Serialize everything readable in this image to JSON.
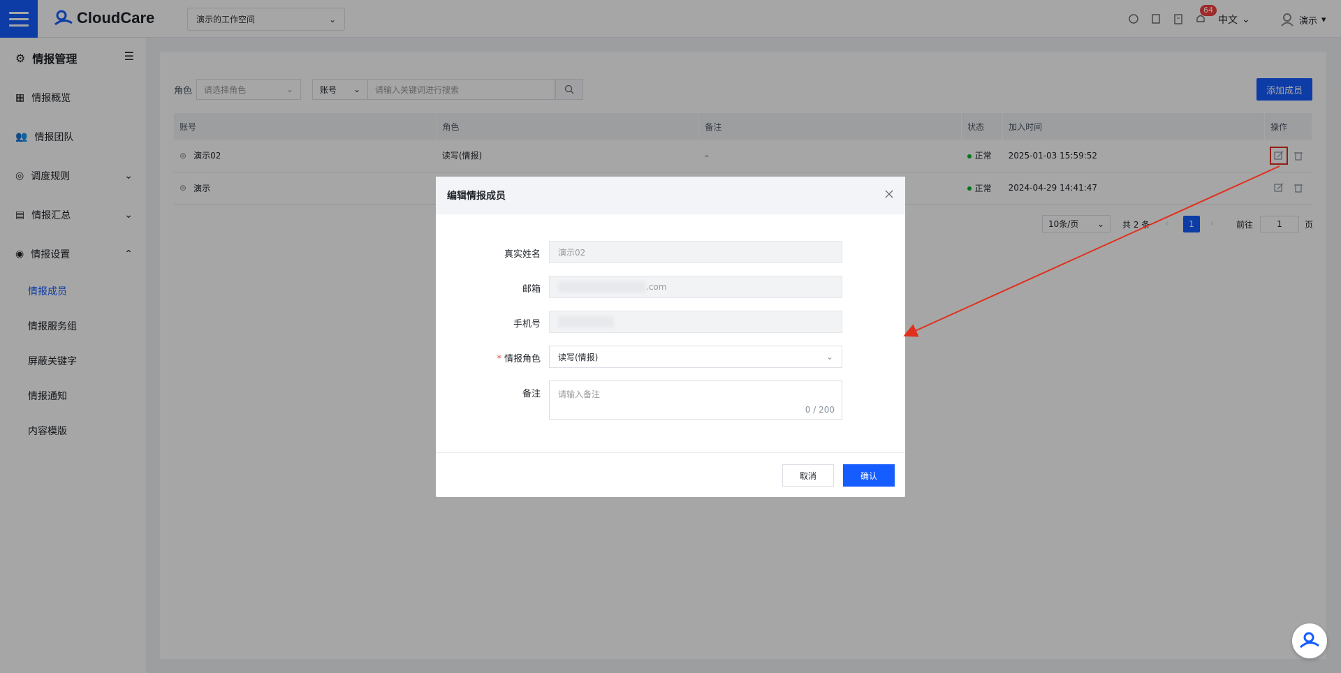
{
  "topbar": {
    "brand": "CloudCare",
    "workspace": "演示的工作空间",
    "notification_count": "64",
    "language": "中文",
    "user": "演示"
  },
  "sidebar": {
    "title": "情报管理",
    "items": [
      {
        "label": "情报概览",
        "icon": "dashboard-icon"
      },
      {
        "label": "情报团队",
        "icon": "team-icon"
      },
      {
        "label": "调度规则",
        "icon": "compass-icon"
      },
      {
        "label": "情报汇总",
        "icon": "document-icon"
      },
      {
        "label": "情报设置",
        "icon": "settings-icon"
      }
    ],
    "sub_items": [
      "情报成员",
      "情报服务组",
      "屏蔽关键字",
      "情报通知",
      "内容模版"
    ]
  },
  "filters": {
    "role_label": "角色",
    "role_placeholder": "请选择角色",
    "field_select": "账号",
    "search_placeholder": "请输入关键词进行搜索",
    "add_button": "添加成员"
  },
  "table": {
    "headers": [
      "账号",
      "角色",
      "备注",
      "状态",
      "加入时间",
      "操作"
    ],
    "rows": [
      {
        "account": "演示02",
        "role": "读写(情报)",
        "note": "–",
        "status": "正常",
        "joined": "2025-01-03 15:59:52"
      },
      {
        "account": "演示",
        "role": "",
        "note": "",
        "status": "正常",
        "joined": "2024-04-29 14:41:47"
      }
    ]
  },
  "pagination": {
    "page_size": "10条/页",
    "total": "共 2 条",
    "current_page": "1",
    "goto_label": "前往",
    "goto_value": "1",
    "page_unit": "页"
  },
  "modal": {
    "title": "编辑情报成员",
    "fields": {
      "name_label": "真实姓名",
      "name_value": "演示02",
      "email_label": "邮箱",
      "email_suffix": ".com",
      "phone_label": "手机号",
      "role_label": "情报角色",
      "role_value": "读写(情报)",
      "note_label": "备注",
      "note_placeholder": "请输入备注",
      "note_count": "0 / 200"
    },
    "cancel": "取消",
    "confirm": "确认"
  },
  "colors": {
    "primary": "#165dff",
    "annotation": "#e0301e",
    "status_ok": "#00b42a"
  }
}
